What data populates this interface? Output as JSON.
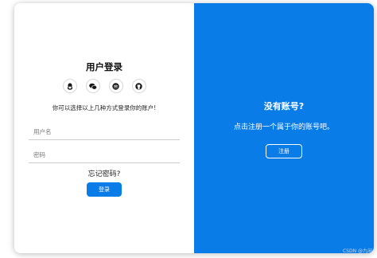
{
  "login": {
    "title": "用户登录",
    "social_icons": [
      "qq-icon",
      "wechat-icon",
      "weibo-icon",
      "github-icon"
    ],
    "hint": "你可以选择以上几种方式登录你的账户!",
    "username_placeholder": "用户名",
    "password_placeholder": "密码",
    "forgot": "忘记密码?",
    "submit_label": "登录"
  },
  "register": {
    "title": "没有账号?",
    "subtitle": "点击注册一个属于你的账号吧。",
    "button_label": "注册"
  },
  "watermark": "CSDN @九闲",
  "colors": {
    "accent": "#0a7ce8",
    "panel_text": "#ffffff"
  }
}
